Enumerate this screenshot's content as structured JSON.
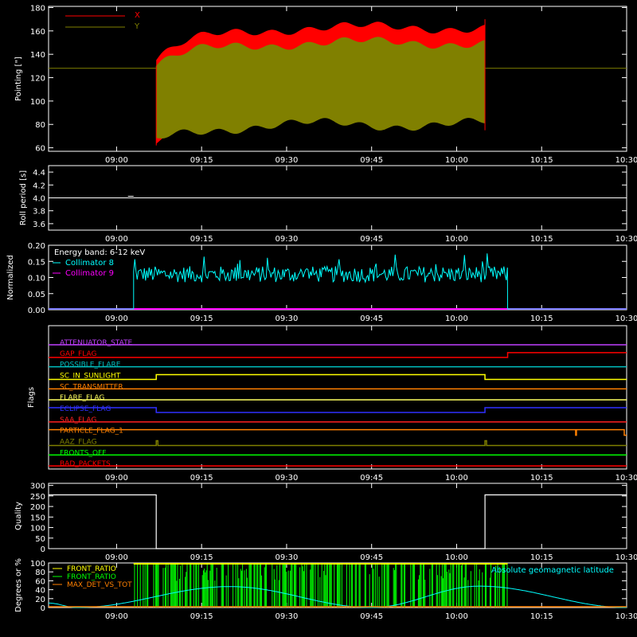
{
  "x_tick_labels": [
    "09:00",
    "09:15",
    "09:30",
    "09:45",
    "10:00",
    "10:15",
    "10:30"
  ],
  "colors": {
    "background": "#000000",
    "axes": "#ffffff",
    "x_pointing": "#ff0000",
    "y_pointing": "#808000",
    "collimator8": "#00ffff",
    "collimator9": "#ff00ff",
    "front_ratio_lo": "#ffff00",
    "front_ratio_hi": "#00ff00",
    "max_det": "#ff8000",
    "geomag": "#00ffff"
  },
  "chart_data": [
    {
      "type": "area",
      "ylabel": "Pointing [\"]",
      "ylim": [
        57,
        181
      ],
      "yticks": [
        60,
        80,
        100,
        120,
        140,
        160,
        180
      ],
      "legend": [
        "X",
        "Y"
      ],
      "legend_placement": "top-left",
      "x_range": [
        "08:48",
        "10:30"
      ],
      "data_start": "09:07",
      "data_end": "10:05",
      "baseline": 128,
      "series": [
        {
          "name": "X",
          "upper_start": 135,
          "upper_plateau": 163,
          "lower_start": 60,
          "lower_plateau": 112
        },
        {
          "name": "Y",
          "upper_start": 130,
          "upper_plateau": 150,
          "lower_start": 65,
          "lower_plateau": 80
        }
      ]
    },
    {
      "type": "line",
      "ylabel": "Roll period [s]",
      "ylim": [
        3.5,
        4.5
      ],
      "yticks": [
        3.6,
        3.8,
        4.0,
        4.2,
        4.4
      ],
      "value": 4.0
    },
    {
      "type": "line",
      "ylabel": "Normalized modulation",
      "ylim": [
        0,
        0.2
      ],
      "yticks": [
        0.0,
        0.05,
        0.1,
        0.15,
        0.2
      ],
      "annotation": "Energy band: 6-12 keV",
      "legend": [
        "Collimator 8",
        "Collimator 9"
      ],
      "data_start": "09:03",
      "data_end": "10:09",
      "mean": 0.11,
      "spread": 0.025
    },
    {
      "type": "line",
      "ylabel": "Flags",
      "flags": [
        {
          "name": "ATTENUATOR_STATE",
          "color": "#c040ff"
        },
        {
          "name": "GAP_FLAG",
          "color": "#ff0000"
        },
        {
          "name": "POSSIBLE_FLARE",
          "color": "#00c0c0"
        },
        {
          "name": "SC_IN_SUNLIGHT",
          "color": "#ffff00"
        },
        {
          "name": "SC_TRANSMITTER",
          "color": "#ff8000"
        },
        {
          "name": "FLARE_FLAG",
          "color": "#ffff60"
        },
        {
          "name": "ECLIPSE_FLAG",
          "color": "#3030ff"
        },
        {
          "name": "SAA_FLAG",
          "color": "#ff2020"
        },
        {
          "name": "PARTICLE_FLAG_1",
          "color": "#ff8000"
        },
        {
          "name": "AAZ_FLAG",
          "color": "#808000"
        },
        {
          "name": "FRONTS_OFF",
          "color": "#00ff00"
        },
        {
          "name": "BAD_PACKETS",
          "color": "#ff0000"
        }
      ]
    },
    {
      "type": "line",
      "ylabel": "Quality",
      "ylim": [
        0,
        310
      ],
      "yticks": [
        0,
        50,
        100,
        150,
        200,
        250,
        300
      ],
      "segments": [
        {
          "from": "08:48",
          "to": "09:07",
          "value": 255
        },
        {
          "from": "09:07",
          "to": "10:05",
          "value": 0
        },
        {
          "from": "10:05",
          "to": "10:30",
          "value": 255
        }
      ]
    },
    {
      "type": "line",
      "ylabel": "Degrees or %",
      "ylim": [
        0,
        100
      ],
      "yticks": [
        0,
        20,
        40,
        60,
        80,
        100
      ],
      "legend": [
        "FRONT_RATIO",
        "FRONT_RATIO",
        "MAX_DET_VS_TOT"
      ],
      "annotation": "Absolute geomagnetic latitude",
      "data_start": "09:03",
      "data_end": "10:09",
      "geomag_extrema": [
        {
          "t": "08:48",
          "v": 10
        },
        {
          "t": "08:53",
          "v": 0
        },
        {
          "t": "09:20",
          "v": 47
        },
        {
          "t": "09:45",
          "v": 0
        },
        {
          "t": "10:04",
          "v": 48
        },
        {
          "t": "10:30",
          "v": 0
        }
      ]
    }
  ]
}
